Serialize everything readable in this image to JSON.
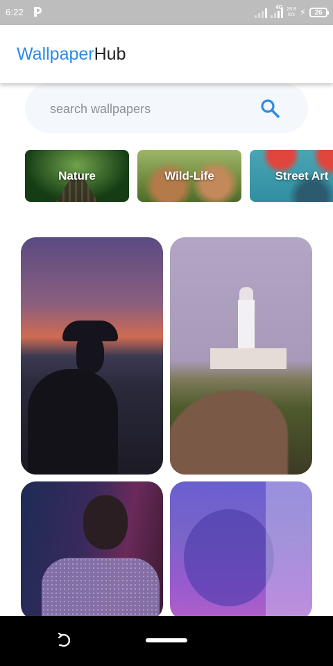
{
  "status_bar": {
    "time": "6:22",
    "app_icon": "p-icon",
    "network_type": "4G",
    "speed_value": "26.8",
    "speed_unit": "K/s",
    "battery_level": "26"
  },
  "app_bar": {
    "title_part1": "Wallpaper",
    "title_part2": "Hub",
    "title_part1_color": "#2c8be6",
    "title_part2_color": "#222222"
  },
  "search": {
    "placeholder": "search wallpapers",
    "value": "",
    "icon": "search-icon",
    "icon_color": "#2c8be6"
  },
  "categories": [
    {
      "label": "Nature"
    },
    {
      "label": "Wild-Life"
    },
    {
      "label": "Street Art"
    }
  ],
  "wallpapers": [
    {
      "subject": "silhouette-at-sunset"
    },
    {
      "subject": "lighthouse"
    },
    {
      "subject": "man-portrait"
    },
    {
      "subject": "purple-tree"
    }
  ],
  "nav_bar": {
    "back_icon": "back-arrow-icon",
    "home_icon": "home-pill-icon"
  }
}
